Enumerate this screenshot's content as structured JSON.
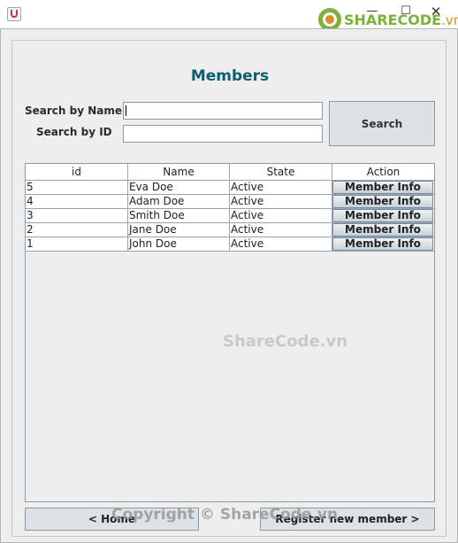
{
  "window": {
    "minimize_glyph": "—",
    "maximize_glyph": "☐",
    "close_glyph": "✕"
  },
  "logo": {
    "brand": "SHARECODE",
    "domain": ".vn"
  },
  "page": {
    "title": "Members"
  },
  "search": {
    "name_label": "Search by Name",
    "name_value": "",
    "id_label": "Search by ID",
    "id_value": "",
    "button_label": "Search"
  },
  "table": {
    "columns": [
      "id",
      "Name",
      "State",
      "Action"
    ],
    "rows": [
      {
        "id": "5",
        "name": "Eva Doe",
        "state": "Active",
        "action": "Member Info"
      },
      {
        "id": "4",
        "name": "Adam Doe",
        "state": "Active",
        "action": "Member Info"
      },
      {
        "id": "3",
        "name": "Smith Doe",
        "state": "Active",
        "action": "Member Info"
      },
      {
        "id": "2",
        "name": "Jane Doe",
        "state": "Active",
        "action": "Member Info"
      },
      {
        "id": "1",
        "name": "John Doe",
        "state": "Active",
        "action": "Member Info"
      }
    ]
  },
  "watermark": "ShareCode.vn",
  "footer": {
    "home_label": "< Home",
    "register_label": "Register new member >",
    "copyright": "Copyright © ShareCode.vn"
  },
  "colors": {
    "title": "#0d5e6e",
    "logo_green": "#7bb23c",
    "logo_orange": "#e08a25"
  }
}
